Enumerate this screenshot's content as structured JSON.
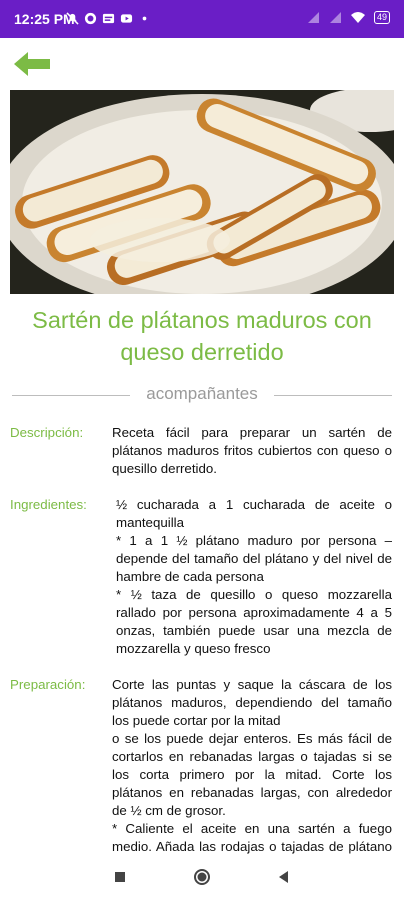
{
  "status": {
    "time": "12:25 PM",
    "battery": "49"
  },
  "appbar": {
    "back_icon": "arrow-left-icon",
    "accent": "#7cbb45"
  },
  "hero": {
    "image": "plate of fried ripe plantains topped with melted cheese"
  },
  "recipe": {
    "title": "Sartén de plátanos maduros con queso derretido",
    "category": "acompañantes",
    "description_label": "Descripción:",
    "description": "Receta fácil para preparar un sartén de plátanos maduros fritos cubiertos con queso o quesillo derretido.",
    "ingredients_label": "Ingredientes:",
    "ingredients": [
      "½ cucharada a 1 cucharada de aceite o mantequilla",
      "* 1 a 1 ½ plátano maduro por persona – depende del tamaño del plátano y del nivel de hambre de cada persona",
      "* ½ taza de quesillo o queso mozzarella rallado por persona aproximadamente 4 a 5 onzas, también puede usar una mezcla de mozzarella y queso fresco"
    ],
    "preparation_label": "Preparación:",
    "preparation": [
      "Corte las puntas y saque la cáscara de los plátanos maduros, dependiendo del tamaño los puede cortar por la mitad",
      "o se los puede dejar enteros. Es más fácil de cortarlos en rebanadas largas o tajadas si se los corta primero por la mitad. Corte los plátanos en rebanadas largas, con alrededor de ½ cm de grosor.",
      "* Caliente el aceite en una sartén a fuego medio. Añada las rodajas o tajadas de plátano maduro y cocine hasta que estén doradas"
    ]
  },
  "navbar": {
    "recents_icon": "square-icon",
    "home_icon": "circle-icon",
    "back_icon": "triangle-back-icon"
  }
}
